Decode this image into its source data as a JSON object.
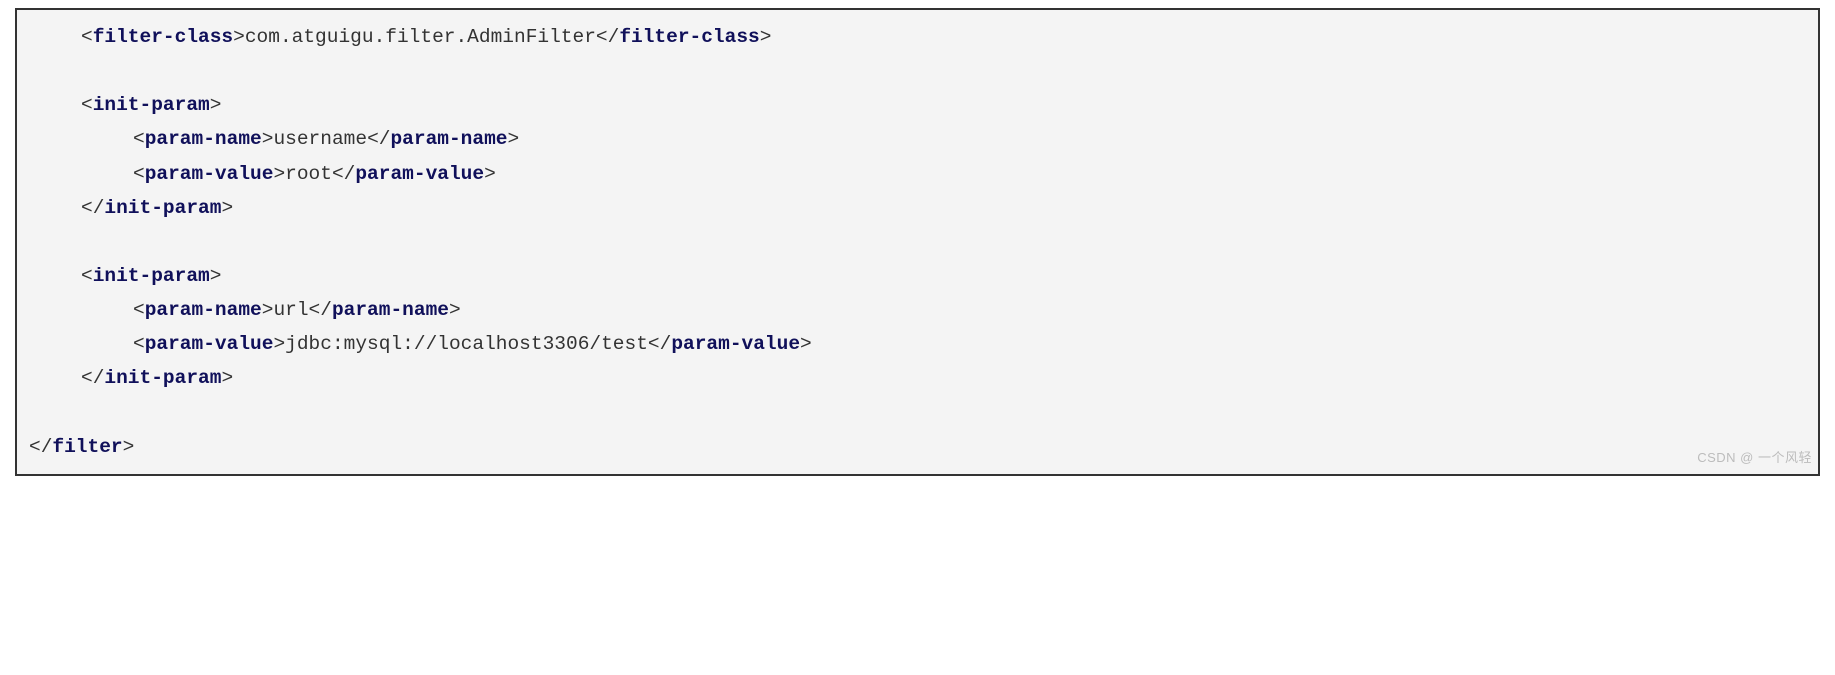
{
  "code": {
    "l1": {
      "open_bracket": "<",
      "tag": "filter-class",
      "close_open": ">",
      "text": "com.atguigu.filter.AdminFilter",
      "open_end": "</",
      "end_tag": "filter-class",
      "close_end": ">"
    },
    "l3": {
      "open_bracket": "<",
      "tag": "init-param",
      "close_open": ">"
    },
    "l4": {
      "open_bracket": "<",
      "tag": "param-name",
      "close_open": ">",
      "text": "username",
      "open_end": "</",
      "end_tag": "param-name",
      "close_end": ">"
    },
    "l5": {
      "open_bracket": "<",
      "tag": "param-value",
      "close_open": ">",
      "text": "root",
      "open_end": "</",
      "end_tag": "param-value",
      "close_end": ">"
    },
    "l6": {
      "open_end": "</",
      "end_tag": "init-param",
      "close_end": ">"
    },
    "l8": {
      "open_bracket": "<",
      "tag": "init-param",
      "close_open": ">"
    },
    "l9": {
      "open_bracket": "<",
      "tag": "param-name",
      "close_open": ">",
      "text": "url",
      "open_end": "</",
      "end_tag": "param-name",
      "close_end": ">"
    },
    "l10": {
      "open_bracket": "<",
      "tag": "param-value",
      "close_open": ">",
      "text": "jdbc:mysql://localhost3306/test",
      "open_end": "</",
      "end_tag": "param-value",
      "close_end": ">"
    },
    "l11": {
      "open_end": "</",
      "end_tag": "init-param",
      "close_end": ">"
    },
    "l13": {
      "open_end": "</",
      "end_tag": "filter",
      "close_end": ">"
    }
  },
  "watermark": "CSDN @ 一个风轻"
}
